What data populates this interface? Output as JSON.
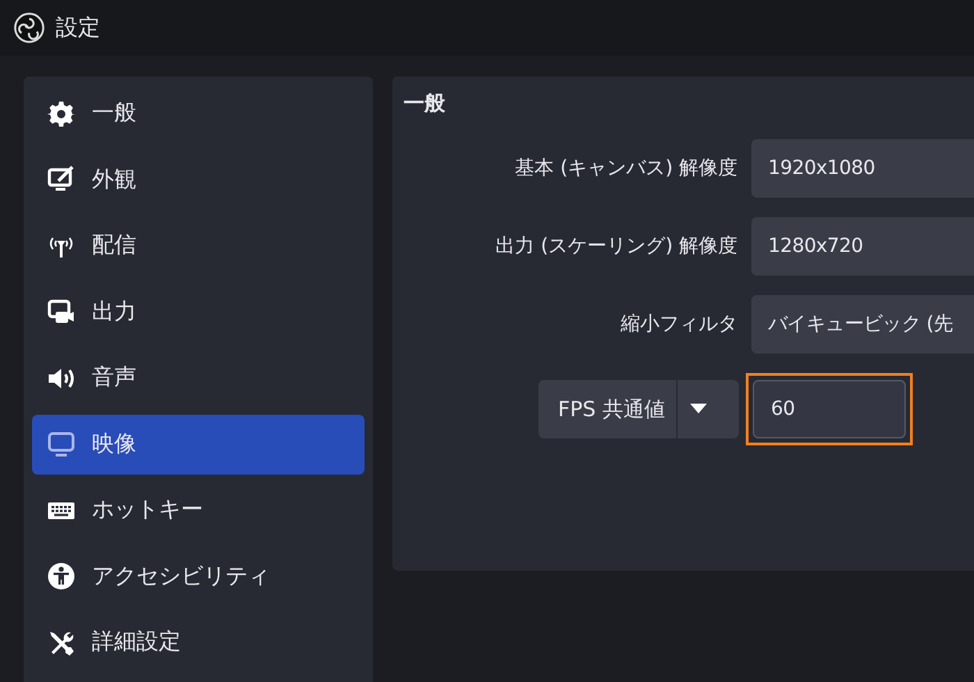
{
  "window": {
    "title": "設定"
  },
  "sidebar": {
    "items": [
      {
        "label": "一般",
        "selected": false
      },
      {
        "label": "外観",
        "selected": false
      },
      {
        "label": "配信",
        "selected": false
      },
      {
        "label": "出力",
        "selected": false
      },
      {
        "label": "音声",
        "selected": false
      },
      {
        "label": "映像",
        "selected": true
      },
      {
        "label": "ホットキー",
        "selected": false
      },
      {
        "label": "アクセシビリティ",
        "selected": false
      },
      {
        "label": "詳細設定",
        "selected": false
      }
    ]
  },
  "panel": {
    "heading": "一般",
    "rows": [
      {
        "kind": "field",
        "label": "基本 (キャンバス) 解像度",
        "value": "1920x1080"
      },
      {
        "kind": "field",
        "label": "出力 (スケーリング) 解像度",
        "value": "1280x720"
      },
      {
        "kind": "field",
        "label": "縮小フィルタ",
        "value": "バイキュービック (先"
      },
      {
        "kind": "fps",
        "label": "FPS 共通値",
        "value": "60",
        "highlighted": true
      }
    ]
  }
}
